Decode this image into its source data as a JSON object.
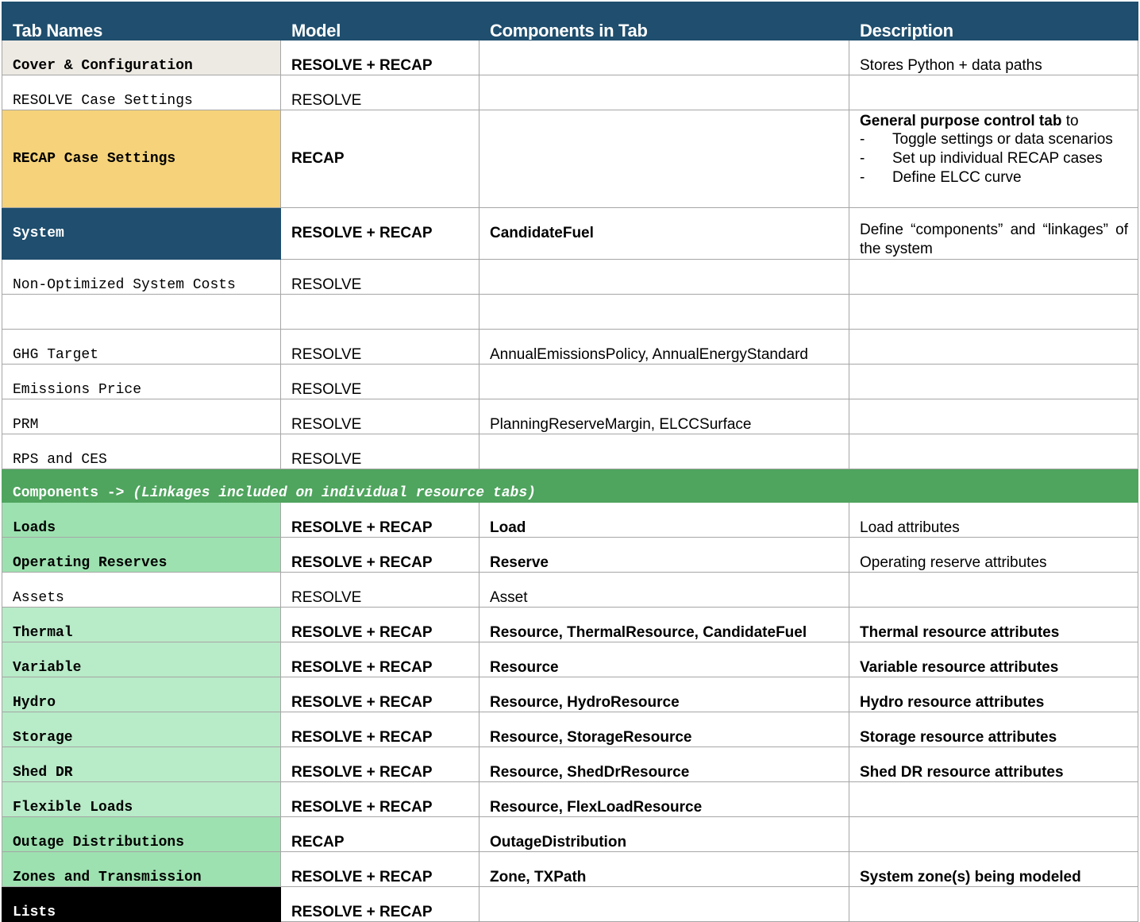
{
  "headers": [
    "Tab Names",
    "Model",
    "Components in Tab",
    "Description"
  ],
  "rows": [
    {
      "tab": "Cover & Configuration",
      "model": "RESOLVE + RECAP",
      "components": "",
      "description": "Stores Python + data paths"
    },
    {
      "tab": "RESOLVE Case Settings",
      "model": "RESOLVE",
      "components": "",
      "description": ""
    },
    {
      "tab": "RECAP Case Settings",
      "model": "RECAP",
      "components": "",
      "description_title": "General purpose control tab",
      "description_suffix": " to",
      "description_items": [
        "Toggle settings or data scenarios",
        "Set up individual RECAP cases",
        "Define ELCC curve"
      ]
    },
    {
      "tab": "System",
      "model": "RESOLVE + RECAP",
      "components": "CandidateFuel",
      "description": "Define “components” and “linkages” of the system"
    },
    {
      "tab": "Non-Optimized System Costs",
      "model": "RESOLVE",
      "components": "",
      "description": ""
    },
    {
      "tab": "",
      "model": "",
      "components": "",
      "description": ""
    },
    {
      "tab": "GHG Target",
      "model": "RESOLVE",
      "components": "AnnualEmissionsPolicy, AnnualEnergyStandard",
      "description": ""
    },
    {
      "tab": "Emissions Price",
      "model": "RESOLVE",
      "components": "",
      "description": ""
    },
    {
      "tab": "PRM",
      "model": "RESOLVE",
      "components": "PlanningReserveMargin, ELCCSurface",
      "description": ""
    },
    {
      "tab": "RPS and CES",
      "model": "RESOLVE",
      "components": "",
      "description": ""
    }
  ],
  "section": {
    "label": "Components -> ",
    "note": "(Linkages included on individual resource tabs)"
  },
  "component_rows": [
    {
      "tab": "Loads",
      "model": "RESOLVE + RECAP",
      "components": "Load",
      "description": "Load attributes"
    },
    {
      "tab": "Operating Reserves",
      "model": "RESOLVE + RECAP",
      "components": "Reserve",
      "description": "Operating reserve attributes"
    },
    {
      "tab": "Assets",
      "model": "RESOLVE",
      "components": "Asset",
      "description": ""
    },
    {
      "tab": "Thermal",
      "model": "RESOLVE + RECAP",
      "components": "Resource, ThermalResource, CandidateFuel",
      "description": "Thermal resource attributes"
    },
    {
      "tab": "Variable",
      "model": "RESOLVE + RECAP",
      "components": "Resource",
      "description": "Variable resource attributes"
    },
    {
      "tab": "Hydro",
      "model": "RESOLVE + RECAP",
      "components": "Resource, HydroResource",
      "description": "Hydro resource attributes"
    },
    {
      "tab": "Storage",
      "model": "RESOLVE + RECAP",
      "components": "Resource, StorageResource",
      "description": "Storage resource attributes"
    },
    {
      "tab": "Shed DR",
      "model": "RESOLVE + RECAP",
      "components": "Resource, ShedDrResource",
      "description": "Shed DR resource attributes"
    },
    {
      "tab": "Flexible Loads",
      "model": "RESOLVE + RECAP",
      "components": "Resource, FlexLoadResource",
      "description": ""
    },
    {
      "tab": "Outage Distributions",
      "model": "RECAP",
      "components": "OutageDistribution",
      "description": ""
    },
    {
      "tab": "Zones and Transmission",
      "model": "RESOLVE + RECAP",
      "components": "Zone, TXPath",
      "description": "System zone(s) being modeled"
    },
    {
      "tab": "Lists",
      "model": "RESOLVE + RECAP",
      "components": "",
      "description": ""
    }
  ],
  "colors": {
    "header_bg": "#1f4e6e",
    "cover_bg": "#edeae3",
    "recap_bg": "#f6d37a",
    "section_bg": "#4fa45e",
    "green_dark": "#9de1b0",
    "green_light": "#b8ebc8",
    "lists_bg": "#000000"
  }
}
